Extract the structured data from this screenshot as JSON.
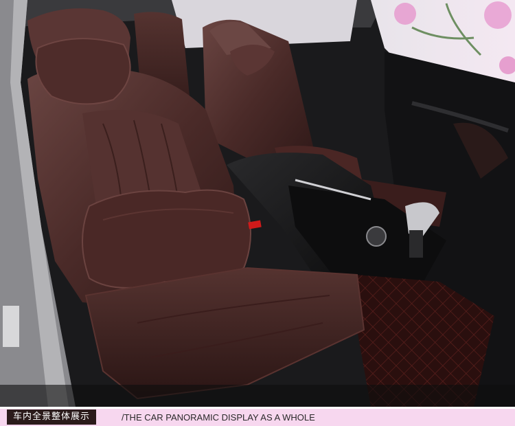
{
  "caption": {
    "zh": "车内全景整体展示",
    "en": "/THE CAR PANORAMIC DISPLAY AS A WHOLE"
  },
  "colors": {
    "seat_leather": "#4a2a28",
    "caption_band": "#f7d7ef",
    "caption_label_bg": "#2b1b1b"
  }
}
